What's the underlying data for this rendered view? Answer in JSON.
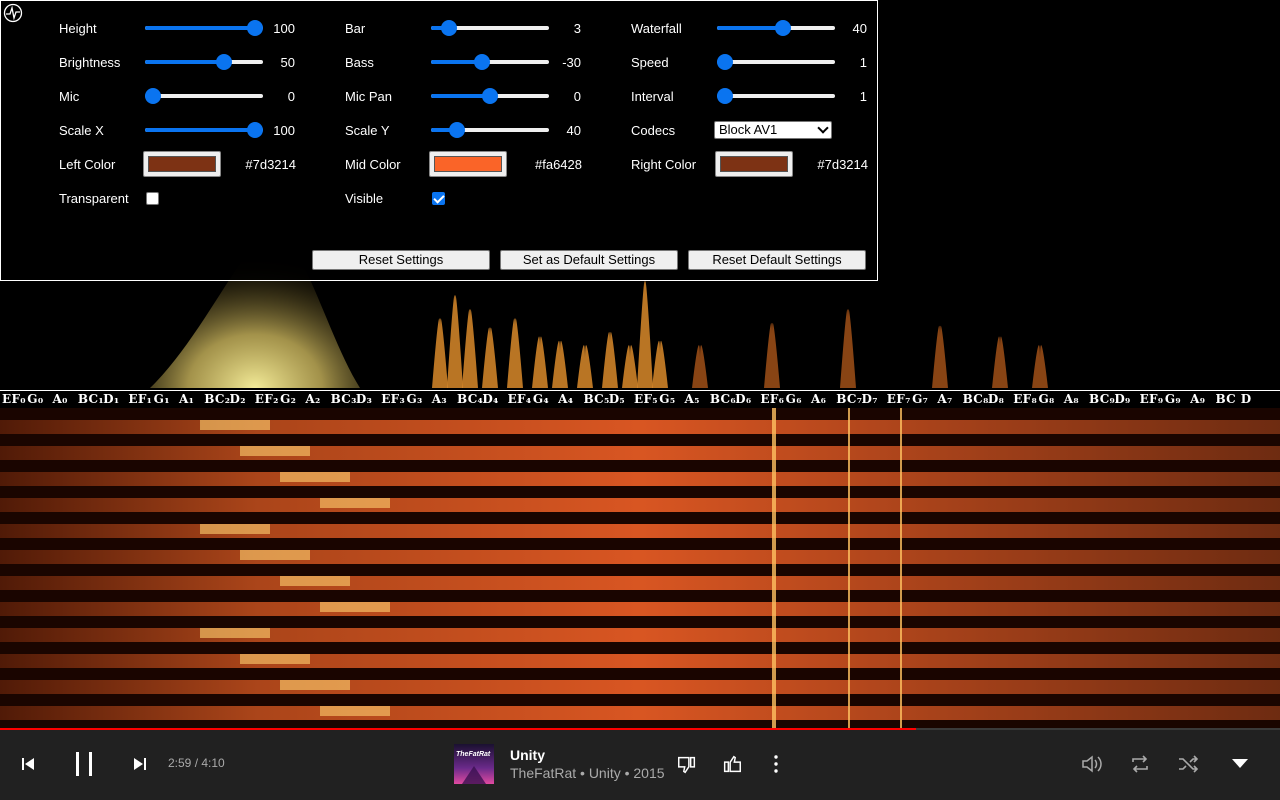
{
  "settings": {
    "col1": {
      "height_label": "Height",
      "height_value": "100",
      "height_level": 1.0,
      "brightness_label": "Brightness",
      "brightness_value": "50",
      "brightness_level": 0.7,
      "mic_label": "Mic",
      "mic_value": "0",
      "mic_level": 0.0,
      "scalex_label": "Scale X",
      "scalex_value": "100",
      "scalex_level": 1.0,
      "leftcolor_label": "Left Color",
      "leftcolor_value": "#7d3214",
      "transparent_label": "Transparent",
      "transparent_checked": false
    },
    "col2": {
      "bar_label": "Bar",
      "bar_value": "3",
      "bar_level": 0.1,
      "bass_label": "Bass",
      "bass_value": "-30",
      "bass_level": 0.42,
      "micpan_label": "Mic Pan",
      "micpan_value": "0",
      "micpan_level": 0.5,
      "scaley_label": "Scale Y",
      "scaley_value": "40",
      "scaley_level": 0.18,
      "midcolor_label": "Mid Color",
      "midcolor_value": "#fa6428",
      "visible_label": "Visible",
      "visible_checked": true
    },
    "col3": {
      "waterfall_label": "Waterfall",
      "waterfall_value": "40",
      "waterfall_level": 0.57,
      "speed_label": "Speed",
      "speed_value": "1",
      "speed_level": 0.0,
      "interval_label": "Interval",
      "interval_value": "1",
      "interval_level": 0.0,
      "codecs_label": "Codecs",
      "codecs_selected": "Block AV1",
      "rightcolor_label": "Right Color",
      "rightcolor_value": "#7d3214"
    },
    "buttons": {
      "reset": "Reset Settings",
      "set_default": "Set as Default Settings",
      "reset_default": "Reset Default Settings"
    }
  },
  "notes": [
    "EF₀",
    "G₀",
    "A₀",
    "BC₁",
    "D₁",
    "EF₁",
    "G₁",
    "A₁",
    "BC₂",
    "D₂",
    "EF₂",
    "G₂",
    "A₂",
    "BC₃",
    "D₃",
    "EF₃",
    "G₃",
    "A₃",
    "BC₄",
    "D₄",
    "EF₄",
    "G₄",
    "A₄",
    "BC₅",
    "D₅",
    "EF₅",
    "G₅",
    "A₅",
    "BC₆",
    "D₆",
    "EF₆",
    "G₆",
    "A₆",
    "BC₇",
    "D₇",
    "EF₇",
    "G₇",
    "A₇",
    "BC₈",
    "D₈",
    "EF₈",
    "G₈",
    "A₈",
    "BC₉",
    "D₉",
    "EF₉",
    "G₉",
    "A₉",
    "BC",
    "D"
  ],
  "player": {
    "time": "2:59 / 4:10",
    "progress": 0.716,
    "title": "Unity",
    "subtitle": "TheFatRat • Unity • 2015",
    "album_art_text": "TheFatRat",
    "icons": [
      "skip-previous-icon",
      "pause-icon",
      "skip-next-icon",
      "dislike-icon",
      "like-icon",
      "more-icon",
      "volume-icon",
      "repeat-icon",
      "shuffle-icon",
      "expand-icon"
    ]
  },
  "colors": {
    "accent": "#0a74f0",
    "left": "#7d3214",
    "mid": "#fa6428",
    "right": "#7d3214",
    "progress": "#ff0000"
  }
}
